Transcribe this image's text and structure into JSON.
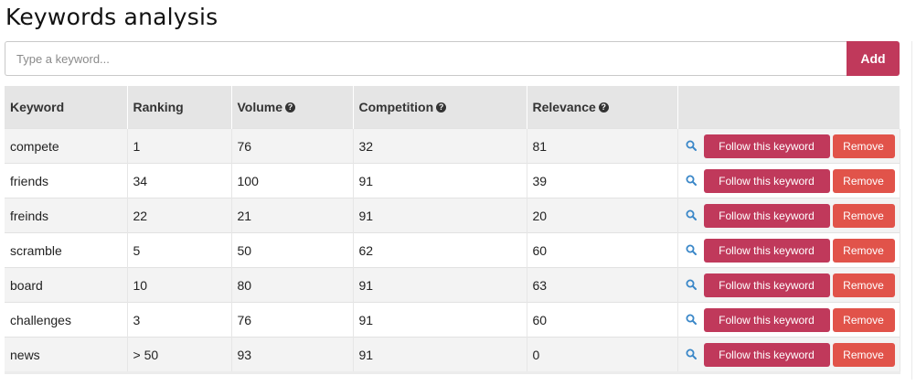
{
  "page": {
    "title": "Keywords analysis"
  },
  "add_form": {
    "placeholder": "Type a keyword...",
    "add_label": "Add"
  },
  "table": {
    "columns": [
      "Keyword",
      "Ranking",
      "Volume",
      "Competition",
      "Relevance",
      ""
    ],
    "help_icon_columns": [
      "Volume",
      "Competition",
      "Relevance"
    ],
    "rows": [
      {
        "keyword": "compete",
        "ranking": "1",
        "volume": "76",
        "competition": "32",
        "relevance": "81"
      },
      {
        "keyword": "friends",
        "ranking": "34",
        "volume": "100",
        "competition": "91",
        "relevance": "39"
      },
      {
        "keyword": "freinds",
        "ranking": "22",
        "volume": "21",
        "competition": "91",
        "relevance": "20"
      },
      {
        "keyword": "scramble",
        "ranking": "5",
        "volume": "50",
        "competition": "62",
        "relevance": "60"
      },
      {
        "keyword": "board",
        "ranking": "10",
        "volume": "80",
        "competition": "91",
        "relevance": "63"
      },
      {
        "keyword": "challenges",
        "ranking": "3",
        "volume": "76",
        "competition": "91",
        "relevance": "60"
      },
      {
        "keyword": "news",
        "ranking": "> 50",
        "volume": "93",
        "competition": "91",
        "relevance": "0"
      }
    ],
    "actions": {
      "follow_label": "Follow this keyword",
      "remove_label": "Remove",
      "search_icon": "search-icon",
      "help_icon": "question-circle-icon"
    }
  },
  "colors": {
    "primary": "#c0395b",
    "danger": "#e1534a",
    "link_icon": "#3a87c8",
    "header_bg": "#e5e5e5"
  }
}
